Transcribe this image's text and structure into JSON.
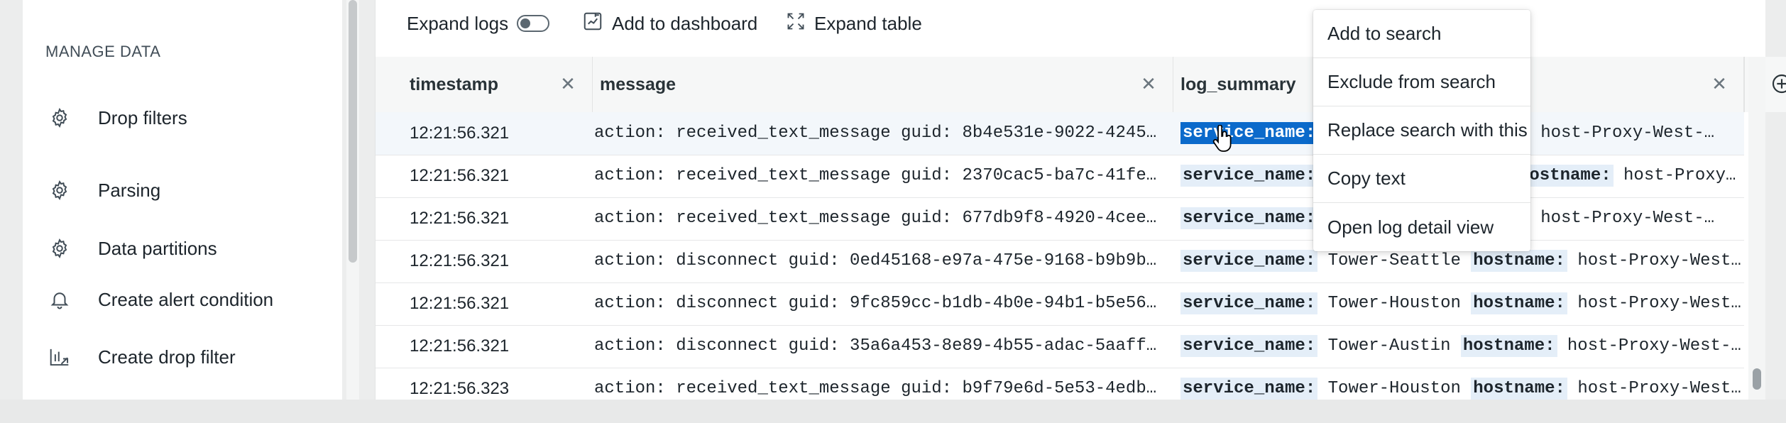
{
  "sidebar": {
    "heading": "MANAGE DATA",
    "items": [
      {
        "label": "Drop filters",
        "icon": "gear-icon"
      },
      {
        "label": "Parsing",
        "icon": "gear-icon"
      },
      {
        "label": "Data partitions",
        "icon": "gear-icon"
      },
      {
        "label": "Create alert condition",
        "icon": "bell-icon"
      },
      {
        "label": "Create drop filter",
        "icon": "drop-filter-icon"
      }
    ]
  },
  "toolbar": {
    "expand_logs": "Expand logs",
    "expand_logs_on": false,
    "add_to_dashboard": "Add to dashboard",
    "expand_table": "Expand table"
  },
  "table": {
    "columns": [
      "timestamp",
      "message",
      "log_summary"
    ],
    "rows": [
      {
        "timestamp": "12:21:56.321",
        "message": "action: received_text_message guid: 8b4e531e-9022-4245…",
        "summary_visible": "service_name:",
        "summary_tail": "e: host-Proxy-West-…",
        "selected": true
      },
      {
        "timestamp": "12:21:56.321",
        "message": "action: received_text_message guid: 2370cac5-ba7c-41fe…",
        "summary_visible": "service_name:",
        "summary_tail_key": "hostname:",
        "summary_tail": "host-Proxy…"
      },
      {
        "timestamp": "12:21:56.321",
        "message": "action: received_text_message guid: 677db9f8-4920-4cee…",
        "summary_visible": "service_name:",
        "summary_tail": "e: host-Proxy-West-…"
      },
      {
        "timestamp": "12:21:56.321",
        "message": "action: disconnect guid: 0ed45168-e97a-475e-9168-b9b9b…",
        "service_name": "service_name:",
        "service": "Tower-Seattle",
        "hostname_key": "hostname:",
        "host": "host-Proxy-West…"
      },
      {
        "timestamp": "12:21:56.321",
        "message": "action: disconnect guid: 9fc859cc-b1db-4b0e-94b1-b5e56…",
        "service_name": "service_name:",
        "service": "Tower-Houston",
        "hostname_key": "hostname:",
        "host": "host-Proxy-West…"
      },
      {
        "timestamp": "12:21:56.321",
        "message": "action: disconnect guid: 35a6a453-8e89-4b55-adac-5aaff…",
        "service_name": "service_name:",
        "service": "Tower-Austin",
        "hostname_key": "hostname:",
        "host": "host-Proxy-West-…"
      },
      {
        "timestamp": "12:21:56.323",
        "message": "action: received_text_message guid: b9f79e6d-5e53-4edb…",
        "service_name": "service_name:",
        "service": "Tower-Houston",
        "hostname_key": "hostname:",
        "host": "host-Proxy-West…"
      }
    ]
  },
  "context_menu": {
    "items": [
      "Add to search",
      "Exclude from search",
      "Replace search with this",
      "Copy text",
      "Open log detail view"
    ]
  },
  "colors": {
    "accent": "#0b6acb",
    "key_bg": "#e4eef8"
  }
}
